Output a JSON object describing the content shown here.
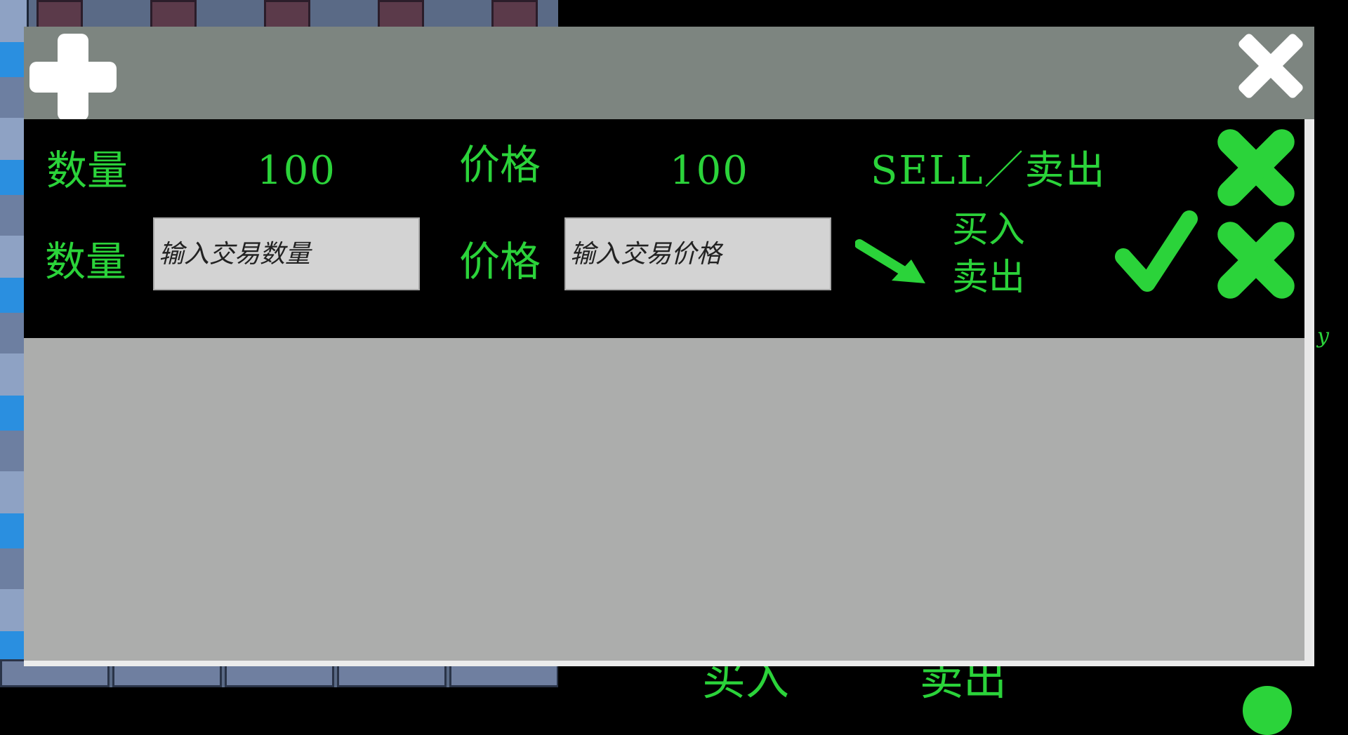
{
  "background": {
    "bottom_left_text": "买入",
    "bottom_right_text": "卖出",
    "edge_letter": "y"
  },
  "dialog": {
    "add_icon": "plus-icon",
    "close_icon": "close-icon"
  },
  "order": {
    "quantity_label": "数量",
    "quantity_value": "100",
    "price_label": "价格",
    "price_value": "100",
    "side": "SELL／卖出",
    "cancel_icon": "close-icon"
  },
  "new_order": {
    "quantity_label": "数量",
    "quantity_placeholder": "输入交易数量",
    "price_label": "价格",
    "price_placeholder": "输入交易价格",
    "buy_label": "买入",
    "sell_label": "卖出",
    "arrow_icon": "arrow-down-right-icon",
    "confirm_icon": "check-icon",
    "cancel_icon": "close-icon"
  },
  "colors": {
    "accent_green": "#2bd33a",
    "header_gray": "#7d8580",
    "body_gray": "#acadac"
  }
}
